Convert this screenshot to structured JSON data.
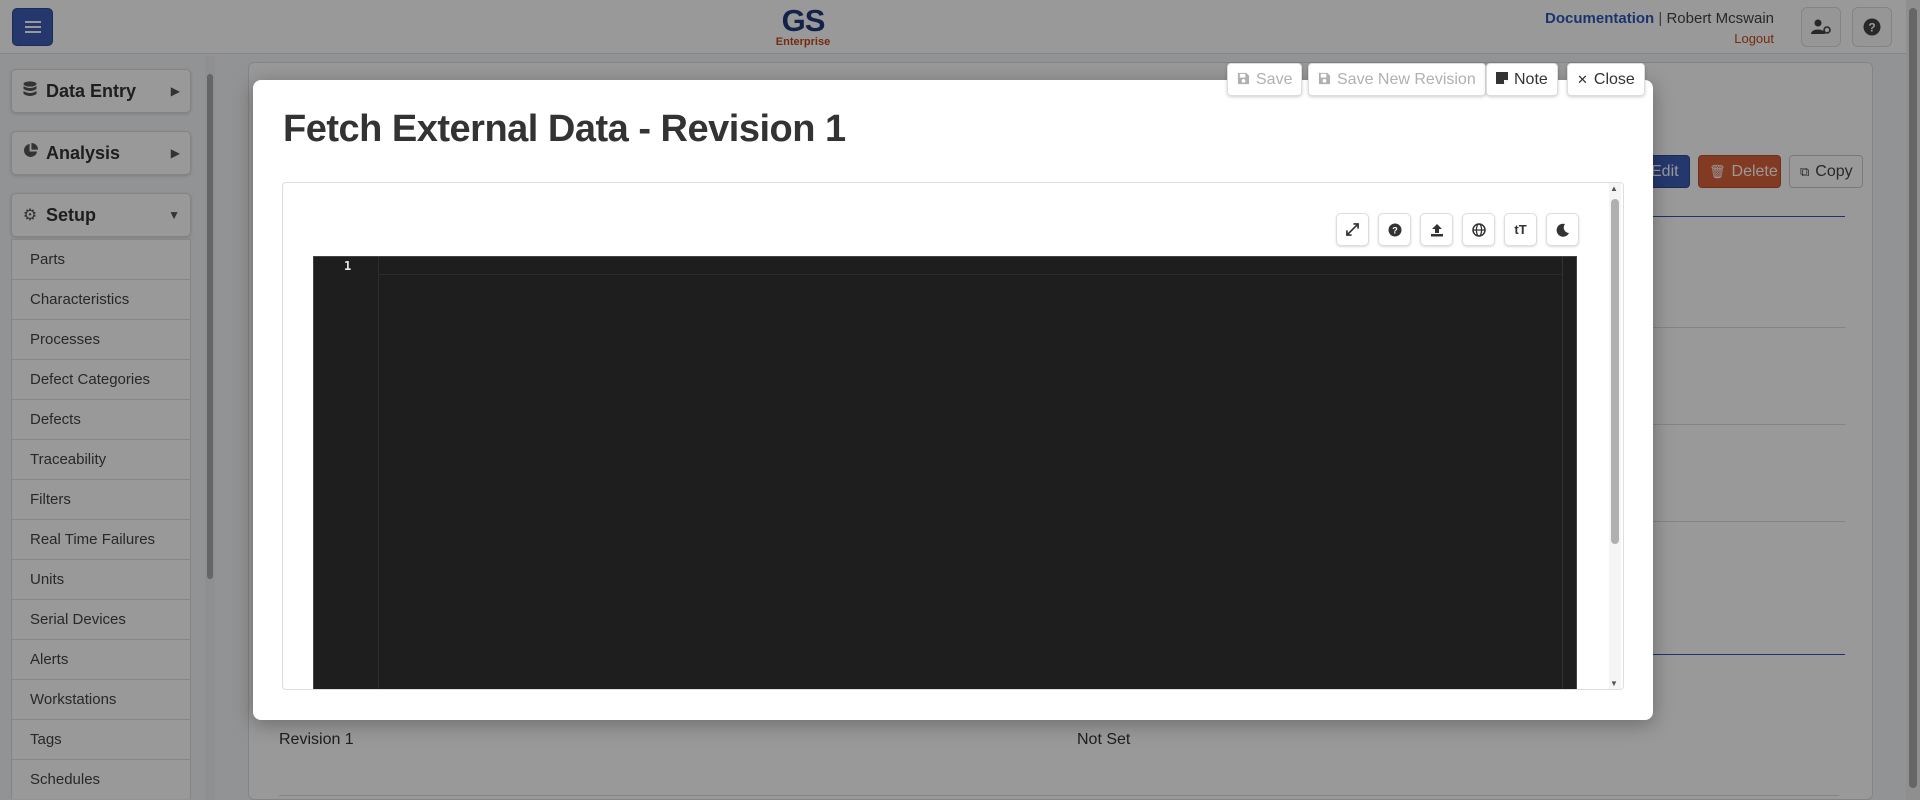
{
  "header": {
    "logo_main": "GS",
    "logo_sub": "Enterprise",
    "documentation_link": "Documentation",
    "separator": "|",
    "user_name": "Robert Mcswain",
    "logout_link": "Logout"
  },
  "sidebar": {
    "groups": [
      {
        "label": "Data Entry",
        "icon": "database-icon"
      },
      {
        "label": "Analysis",
        "icon": "pie-chart-icon"
      },
      {
        "label": "Setup",
        "icon": "gear-icon"
      }
    ],
    "setup_items": [
      "Parts",
      "Characteristics",
      "Processes",
      "Defect Categories",
      "Defects",
      "Traceability",
      "Filters",
      "Real Time Failures",
      "Units",
      "Serial Devices",
      "Alerts",
      "Workstations",
      "Tags",
      "Schedules"
    ]
  },
  "background": {
    "edit_label": "Edit",
    "delete_label": "Delete",
    "copy_label": "Copy",
    "revision_value": "Revision 1",
    "status_value": "Not Set"
  },
  "modal": {
    "title": "Fetch External Data - Revision 1",
    "save_label": "Save",
    "save_new_revision_label": "Save New Revision",
    "note_label": "Note",
    "close_label": "Close",
    "toolbar_icons": [
      "expand-icon",
      "help-icon",
      "upload-icon",
      "globe-icon",
      "text-size-icon",
      "moon-icon"
    ],
    "text_size_glyph": "tT",
    "editor": {
      "line_numbers": [
        "1"
      ],
      "content": ""
    }
  }
}
